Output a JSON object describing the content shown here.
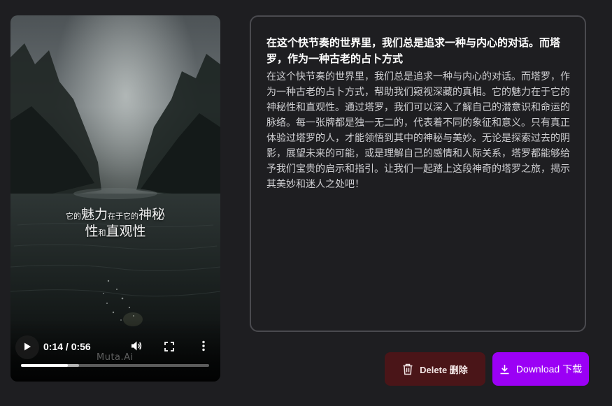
{
  "video": {
    "caption_line1_small_a": "它的",
    "caption_line1_large_a": "魅力",
    "caption_line1_small_b": "在于它的",
    "caption_line1_large_b": "神秘",
    "caption_line2_large_a": "性",
    "caption_line2_small": "和",
    "caption_line2_large_b": "直观性",
    "watermark": "Muta.Ai",
    "current_time": "0:14",
    "duration": "0:56",
    "time_display": "0:14 / 0:56",
    "progress_fraction": 0.25,
    "buffered_fraction": 0.31
  },
  "panel": {
    "title": "在这个快节奏的世界里，我们总是追求一种与内心的对话。而塔罗，作为一种古老的占卜方式",
    "body": "在这个快节奏的世界里，我们总是追求一种与内心的对话。而塔罗，作为一种古老的占卜方式，帮助我们窥视深藏的真相。它的魅力在于它的神秘性和直观性。通过塔罗，我们可以深入了解自己的潜意识和命运的脉络。每一张牌都是独一无二的，代表着不同的象征和意义。只有真正体验过塔罗的人，才能领悟到其中的神秘与美妙。无论是探索过去的阴影，展望未来的可能，或是理解自己的感情和人际关系，塔罗都能够给予我们宝贵的启示和指引。让我们一起踏上这段神奇的塔罗之旅，揭示其美妙和迷人之处吧！"
  },
  "actions": {
    "delete_label": "Delete 删除",
    "download_label": "Download 下载"
  },
  "colors": {
    "background": "#1e1e21",
    "panel_border": "#4a4a4f",
    "delete_bg": "#4a1518",
    "download_bg": "#9b00f5"
  },
  "icons": {
    "play": "play-icon",
    "volume": "volume-icon",
    "fullscreen": "fullscreen-icon",
    "more": "more-vertical-icon",
    "delete": "trash-icon",
    "download": "download-icon"
  }
}
